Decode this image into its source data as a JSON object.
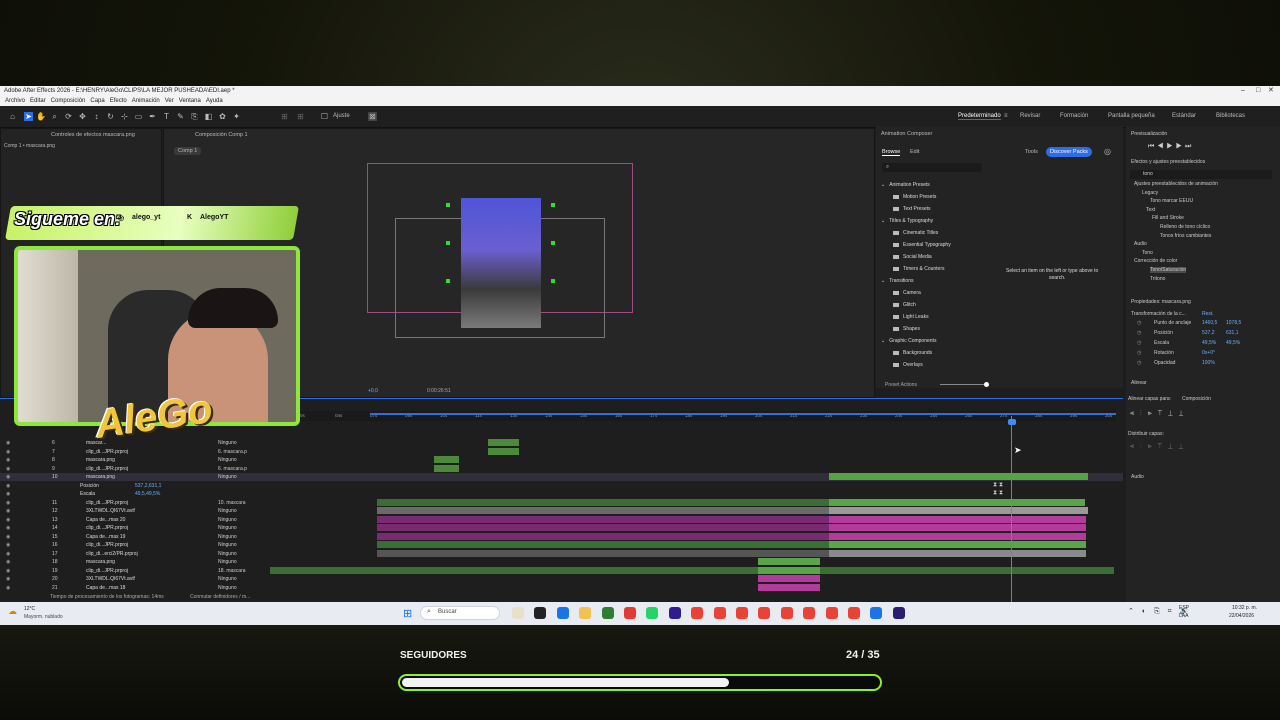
{
  "app": {
    "title": "Adobe After Effects 2026 - E:\\HENRY\\AleGo\\CLIPS\\LA MEJOR PUSHEADA\\EDI.aep *",
    "menu": [
      "Archivo",
      "Editar",
      "Composición",
      "Capa",
      "Efecto",
      "Animación",
      "Ver",
      "Ventana",
      "Ayuda"
    ]
  },
  "toolbar": {
    "snap_label": "Ajuste",
    "workspaces": [
      "Predeterminado",
      "Revisar",
      "Formación",
      "Pantalla pequeña",
      "Estándar",
      "Bibliotecas"
    ]
  },
  "effects_panel": {
    "tab": "Controles de efectos mascara.png",
    "subtitle": "Comp 1 • mascara.png"
  },
  "composition_panel": {
    "tab": "Composición Comp 1",
    "chip": "Comp 1",
    "zoom": "+0,0",
    "time": "0:00:26:51"
  },
  "animation_composer": {
    "tab": "Animation Composer",
    "tabs": [
      "Browse",
      "Edit"
    ],
    "tools_label": "Tools",
    "discover_button": "Discover Packs",
    "empty_message_line1": "Select an item on the left or type above to",
    "empty_message_line2": "search.",
    "preset_actions": "Preset Actions",
    "items": [
      {
        "label": "Animation Presets",
        "level": 0
      },
      {
        "label": "Motion Presets",
        "level": 1
      },
      {
        "label": "Text Presets",
        "level": 1
      },
      {
        "label": "Titles & Typography",
        "level": 0
      },
      {
        "label": "Cinematic Titles",
        "level": 1
      },
      {
        "label": "Essential Typography",
        "level": 1
      },
      {
        "label": "Social Media",
        "level": 1
      },
      {
        "label": "Timers & Counters",
        "level": 1
      },
      {
        "label": "Transitions",
        "level": 0
      },
      {
        "label": "Camera",
        "level": 1
      },
      {
        "label": "Glitch",
        "level": 1
      },
      {
        "label": "Light Leaks",
        "level": 1
      },
      {
        "label": "Shapes",
        "level": 1
      },
      {
        "label": "Graphic Components",
        "level": 0
      },
      {
        "label": "Backgrounds",
        "level": 1
      },
      {
        "label": "Overlays",
        "level": 1
      }
    ]
  },
  "right_panel": {
    "preview_tab": "Previsualización",
    "effects_tab": "Efectos y ajustes preestablecidos",
    "search_value": "tono",
    "tree": [
      "Ajustes preestablecidos de animación",
      "Legacy",
      "Tono marcar EEUU",
      "Text",
      "Fill and Stroke",
      "Relleno de tono cíclico",
      "Tonos fríos cambiantes",
      "Audio",
      "Tono",
      "Corrección de color",
      "Tono/Saturación",
      "Tritono"
    ],
    "properties_tab": "Propiedades: mascara.png",
    "transform_label": "Transformación de la c...",
    "reset_label": "Rest.",
    "props": [
      {
        "label": "Punto de anclaje",
        "v1": "1460,5",
        "v2": "1078,5"
      },
      {
        "label": "Posición",
        "v1": "537,2",
        "v2": "631,1"
      },
      {
        "label": "Escala",
        "v1": "49,5%",
        "v2": "49,5%"
      },
      {
        "label": "Rotación",
        "v1": "0x+0°",
        "v2": ""
      },
      {
        "label": "Opacidad",
        "v1": "100%",
        "v2": ""
      }
    ],
    "align_tab": "Alinear",
    "align_to_label": "Alinear capas para:",
    "align_to_value": "Composición",
    "distribute_label": "Distribuir capas:",
    "audio_tab": "Audio"
  },
  "timeline": {
    "ruler": [
      "0s",
      "04s",
      "07s",
      "09s",
      "10s",
      "11s",
      "13s",
      "14s",
      "15s",
      "16s",
      "17s",
      "18s",
      "19s",
      "20s",
      "21s",
      "22s",
      "23s",
      "24s",
      "25s",
      "26s",
      "27s",
      "28s",
      "29s",
      "30s"
    ],
    "layers": [
      {
        "num": "6",
        "name": "mascar...",
        "parent": "Ninguno"
      },
      {
        "num": "7",
        "name": "clip_di...JPR.prproj",
        "parent": "6. mascara.p"
      },
      {
        "num": "8",
        "name": "mascara.png",
        "parent": "Ninguno"
      },
      {
        "num": "9",
        "name": "clip_di...JPR.prproj",
        "parent": "6. mascara.p"
      },
      {
        "num": "10",
        "name": "mascara.png",
        "parent": "Ninguno"
      },
      {
        "num": "",
        "name": "Posición",
        "parent": "537,2,631,1"
      },
      {
        "num": "",
        "name": "Escala",
        "parent": "49,5,49,5%"
      },
      {
        "num": "11",
        "name": "clip_di...JPR.prproj",
        "parent": "10. mascara"
      },
      {
        "num": "12",
        "name": "3XLTWDL.QI67Vt.avif",
        "parent": "Ninguno"
      },
      {
        "num": "13",
        "name": "Capa de...mas 20",
        "parent": "Ninguno"
      },
      {
        "num": "14",
        "name": "clip_di...JPR.prproj",
        "parent": "Ninguno"
      },
      {
        "num": "15",
        "name": "Capa de...mas 19",
        "parent": "Ninguno"
      },
      {
        "num": "16",
        "name": "clip_di...JPR.prproj",
        "parent": "Ninguno"
      },
      {
        "num": "17",
        "name": "clip_di...erci2/PR.prproj",
        "parent": "Ninguno"
      },
      {
        "num": "18",
        "name": "mascara.png",
        "parent": "Ninguno"
      },
      {
        "num": "19",
        "name": "clip_di...JPR.prproj",
        "parent": "18. mascara"
      },
      {
        "num": "20",
        "name": "3XLTWDL.QI67Vt.avif",
        "parent": "Ninguno"
      },
      {
        "num": "21",
        "name": "Capa de...mas 18",
        "parent": "Ninguno"
      }
    ],
    "footer_left": "Tiempo de procesamiento de los fotogramas: 14ms",
    "footer_mid": "Conmutar definidores / m..."
  },
  "overlay": {
    "sigueme": "Sigueme en:",
    "handle1": "alego_yt",
    "handle2": "AlegoYT",
    "logo_text": "AleGo"
  },
  "taskbar": {
    "weather_temp": "12°C",
    "weather_desc": "Mayorm. nublado",
    "search": "Buscar",
    "lang": "ESP",
    "lang2": "LAA",
    "time": "10:32 p. m.",
    "date": "22/04/2026"
  },
  "followers": {
    "label": "SEGUIDORES",
    "count_text": "24 / 35",
    "progress": 0.686
  },
  "colors": {
    "accent_green": "#8df02a",
    "ae_blue": "#2d6ee6",
    "clip_purple": "#b33b9c",
    "clip_green": "#4a9a3a"
  }
}
